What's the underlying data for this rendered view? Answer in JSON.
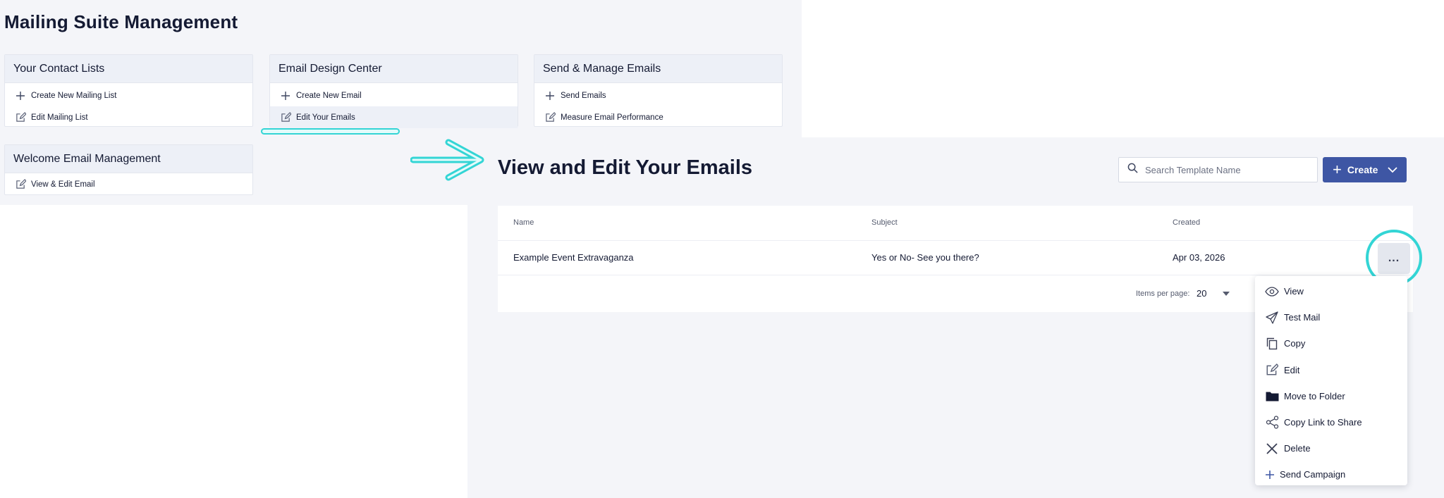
{
  "page": {
    "title": "Mailing Suite Management"
  },
  "cards": [
    {
      "header": "Your Contact Lists",
      "items": [
        {
          "label": "Create New Mailing List",
          "icon": "plus-icon"
        },
        {
          "label": "Edit Mailing List",
          "icon": "edit-icon"
        }
      ]
    },
    {
      "header": "Email Design Center",
      "items": [
        {
          "label": "Create New Email",
          "icon": "plus-icon"
        },
        {
          "label": "Edit Your Emails",
          "icon": "edit-icon"
        }
      ]
    },
    {
      "header": "Send & Manage Emails",
      "items": [
        {
          "label": "Send Emails",
          "icon": "plus-icon"
        },
        {
          "label": "Measure Email Performance",
          "icon": "edit-icon"
        }
      ]
    },
    {
      "header": "Welcome Email Management",
      "items": [
        {
          "label": "View & Edit Email",
          "icon": "edit-icon"
        }
      ]
    }
  ],
  "edit_view": {
    "title": "View and Edit Your Emails",
    "search": {
      "placeholder": "Search Template Name"
    },
    "create_label": "Create",
    "columns": [
      "Name",
      "Subject",
      "Created"
    ],
    "rows": [
      {
        "name": "Example Event Extravaganza",
        "subject": "Yes or No- See you there?",
        "created": "Apr 03, 2026"
      }
    ],
    "pagination": {
      "items_per_page_label": "Items per page:",
      "items_per_page_value": "20"
    },
    "more_label": "...",
    "menu": [
      {
        "label": "View",
        "icon": "eye-icon"
      },
      {
        "label": "Test Mail",
        "icon": "paper-plane-icon"
      },
      {
        "label": "Copy",
        "icon": "copy-icon"
      },
      {
        "label": "Edit",
        "icon": "edit-icon"
      },
      {
        "label": "Move to Folder",
        "icon": "folder-icon"
      },
      {
        "label": "Copy Link to Share",
        "icon": "share-icon"
      },
      {
        "label": "Delete",
        "icon": "close-icon"
      },
      {
        "label": "Send Campaign",
        "icon": "plus-icon"
      }
    ]
  },
  "colors": {
    "accent": "#3e56a4",
    "highlight": "#33d5d5",
    "panel_bg": "#f4f5f9",
    "card_header_bg": "#edf0f7"
  }
}
